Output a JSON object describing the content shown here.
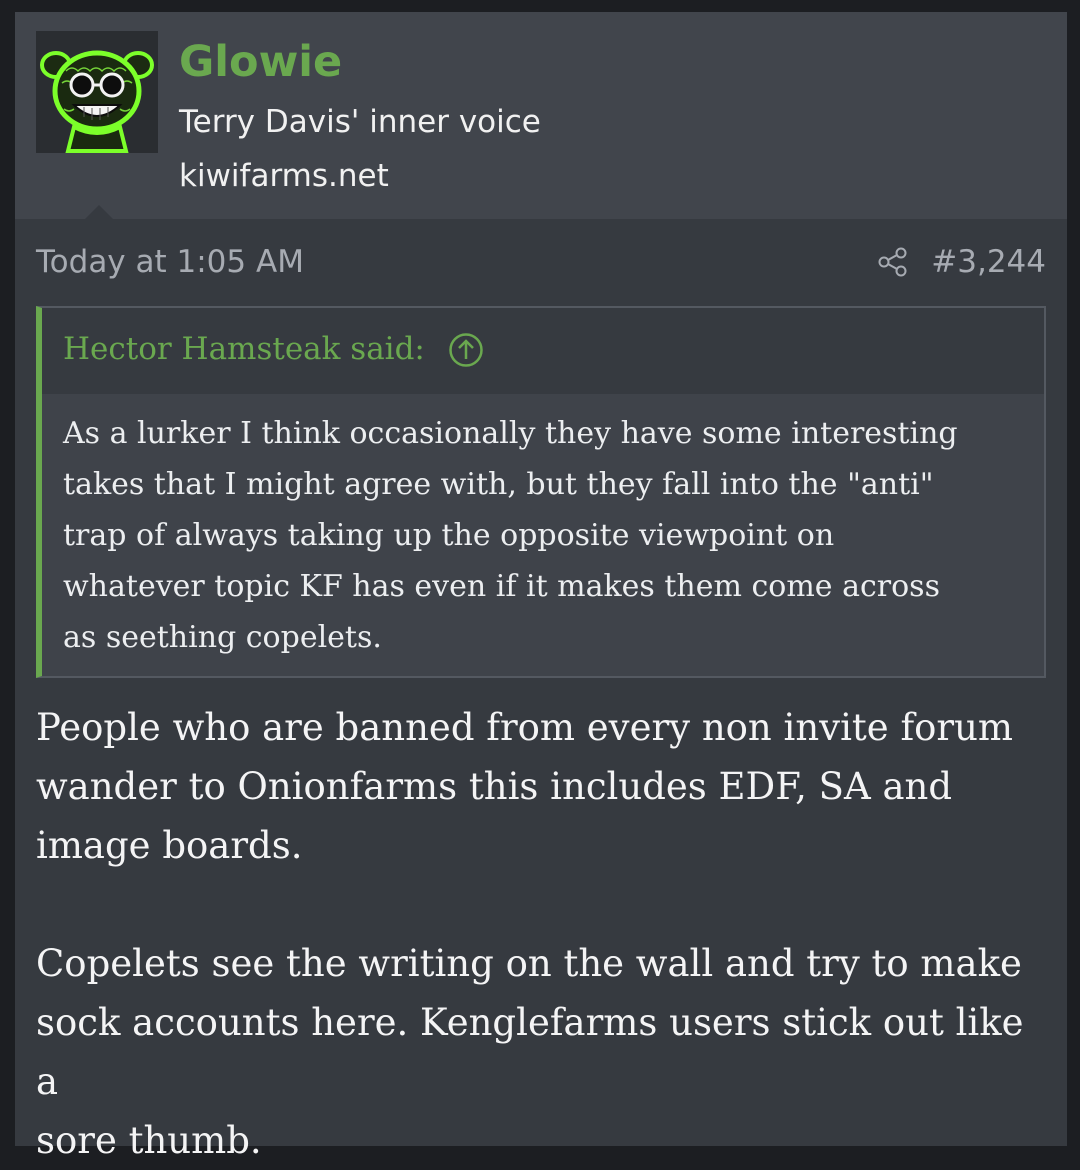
{
  "user": {
    "name": "Glowie",
    "title": "Terry Davis' inner voice",
    "site": "kiwifarms.net"
  },
  "post": {
    "date": "Today at 1:05 AM",
    "number": "#3,244"
  },
  "quote": {
    "author": "Hector Hamsteak said:",
    "lines": [
      "As a lurker I think occasionally they have some interesting",
      "takes that I might agree with, but they fall into the \"anti\"",
      "trap of always taking up the opposite viewpoint on",
      "whatever topic KF has even if it makes them come across",
      "as seething copelets."
    ]
  },
  "message": {
    "p1_lines": [
      "People who are banned from every non invite forum",
      "wander to Onionfarms this includes EDF, SA and",
      "image boards."
    ],
    "p2_lines": [
      "Copelets see the writing on the wall and try to make",
      "sock accounts here. Kenglefarms users stick out like a",
      "sore thumb."
    ]
  },
  "colors": {
    "accent": "#6aa84f",
    "post_bg": "#363a40",
    "userbar_bg": "#41454c",
    "quote_bg": "#3f434a"
  }
}
